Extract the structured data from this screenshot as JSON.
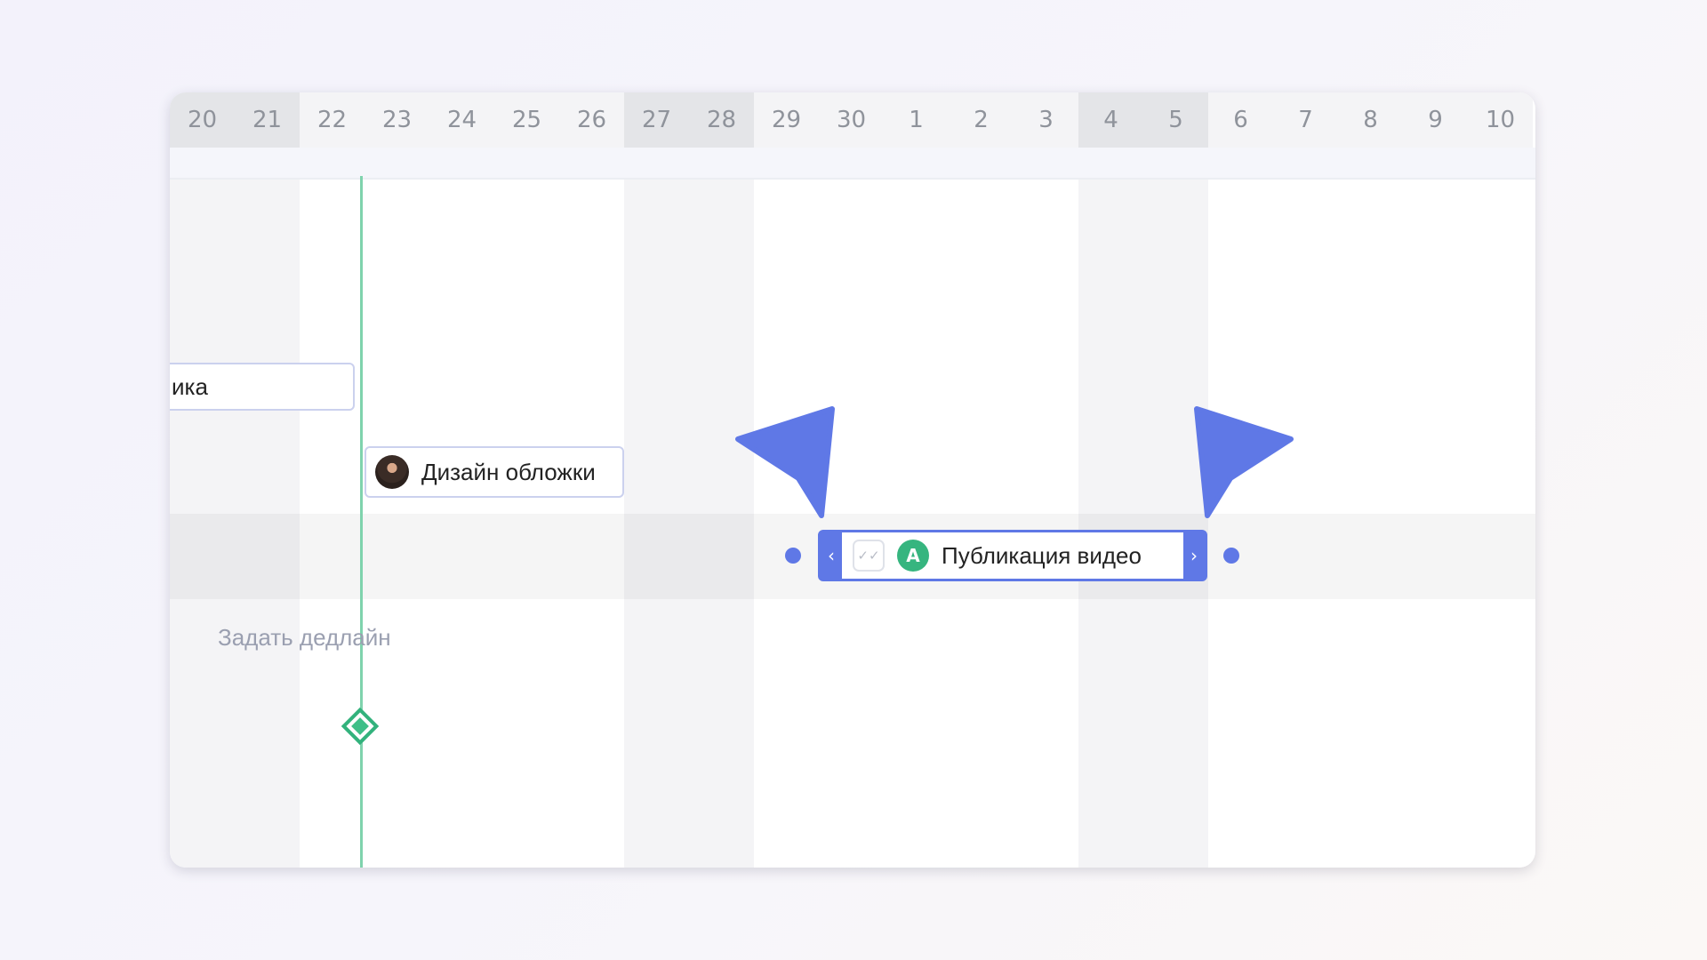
{
  "timeline": {
    "days": [
      {
        "label": "20",
        "weekend": true
      },
      {
        "label": "21",
        "weekend": true
      },
      {
        "label": "22",
        "weekend": false
      },
      {
        "label": "23",
        "weekend": false
      },
      {
        "label": "24",
        "weekend": false
      },
      {
        "label": "25",
        "weekend": false
      },
      {
        "label": "26",
        "weekend": false
      },
      {
        "label": "27",
        "weekend": true
      },
      {
        "label": "28",
        "weekend": true
      },
      {
        "label": "29",
        "weekend": false
      },
      {
        "label": "30",
        "weekend": false
      },
      {
        "label": "1",
        "weekend": false
      },
      {
        "label": "2",
        "weekend": false
      },
      {
        "label": "3",
        "weekend": false
      },
      {
        "label": "4",
        "weekend": true
      },
      {
        "label": "5",
        "weekend": true
      },
      {
        "label": "6",
        "weekend": false
      },
      {
        "label": "7",
        "weekend": false
      },
      {
        "label": "8",
        "weekend": false
      },
      {
        "label": "9",
        "weekend": false
      },
      {
        "label": "10",
        "weekend": false
      }
    ]
  },
  "tasks": {
    "partial_label": "ика",
    "design_label": "Дизайн обложки",
    "publication_label": "Публикация видео",
    "publication_avatar_letter": "A",
    "prev_handle": "‹",
    "next_handle": "›",
    "check_glyph": "✓✓"
  },
  "deadline": {
    "label": "Задать дедлайн"
  },
  "colors": {
    "accent": "#5f78e6",
    "today_line": "#7fd3ad",
    "milestone": "#32b27c",
    "avatar_green": "#36b57f"
  },
  "icons": {
    "cursor_left": "pointer-cursor-icon",
    "cursor_right": "pointer-cursor-icon",
    "milestone": "diamond-icon"
  }
}
